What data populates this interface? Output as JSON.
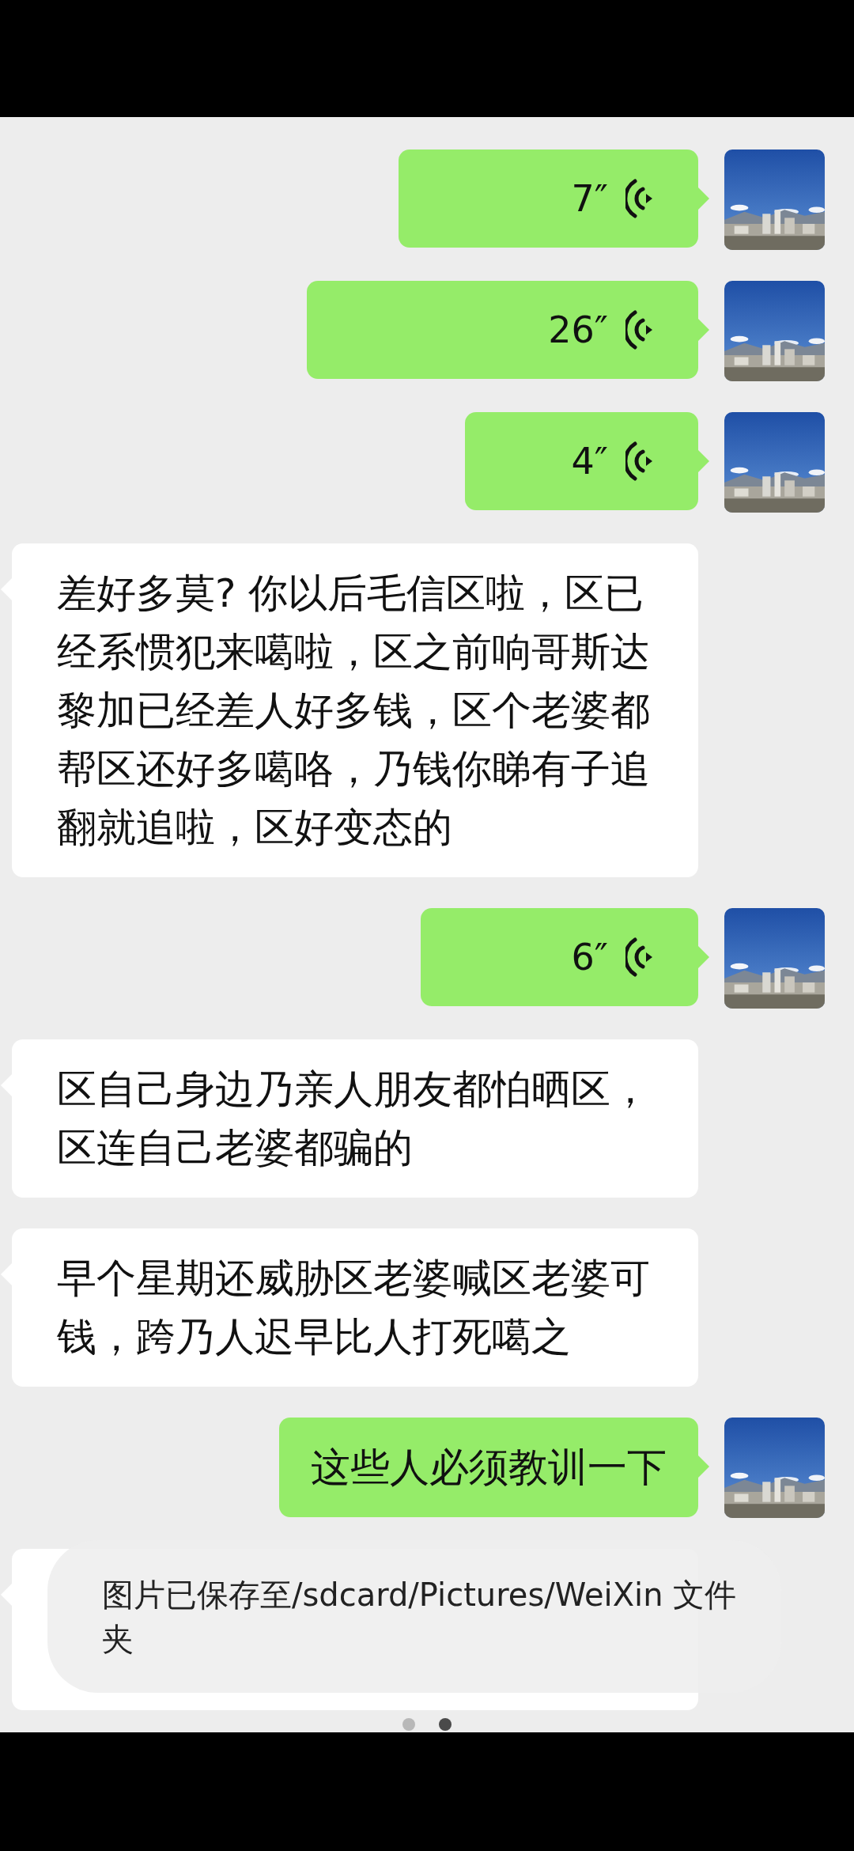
{
  "messages": [
    {
      "kind": "voice",
      "outgoing": true,
      "duration": "7″"
    },
    {
      "kind": "voice",
      "outgoing": true,
      "duration": "26″"
    },
    {
      "kind": "voice",
      "outgoing": true,
      "duration": "4″"
    },
    {
      "kind": "text",
      "outgoing": false,
      "text": "差好多莫? 你以后毛信区啦，区已经系惯犯来噶啦，区之前响哥斯达黎加已经差人好多钱，区个老婆都帮区还好多噶咯，乃钱你睇有子追翻就追啦，区好变态的"
    },
    {
      "kind": "voice",
      "outgoing": true,
      "duration": "6″"
    },
    {
      "kind": "text",
      "outgoing": false,
      "text": "区自己身边乃亲人朋友都怕晒区，区连自己老婆都骗的"
    },
    {
      "kind": "text",
      "outgoing": false,
      "text": "早个星期还威胁区老婆喊区老婆可钱，跨乃人迟早比人打死噶之"
    },
    {
      "kind": "text",
      "outgoing": true,
      "text": "这些人必须教训一下"
    },
    {
      "kind": "covered",
      "outgoing": false
    }
  ],
  "toast": {
    "text": "图片已保存至/sdcard/Pictures/WeiXin 文件夹"
  },
  "page_dots": [
    {
      "selected": false
    },
    {
      "selected": true
    }
  ]
}
